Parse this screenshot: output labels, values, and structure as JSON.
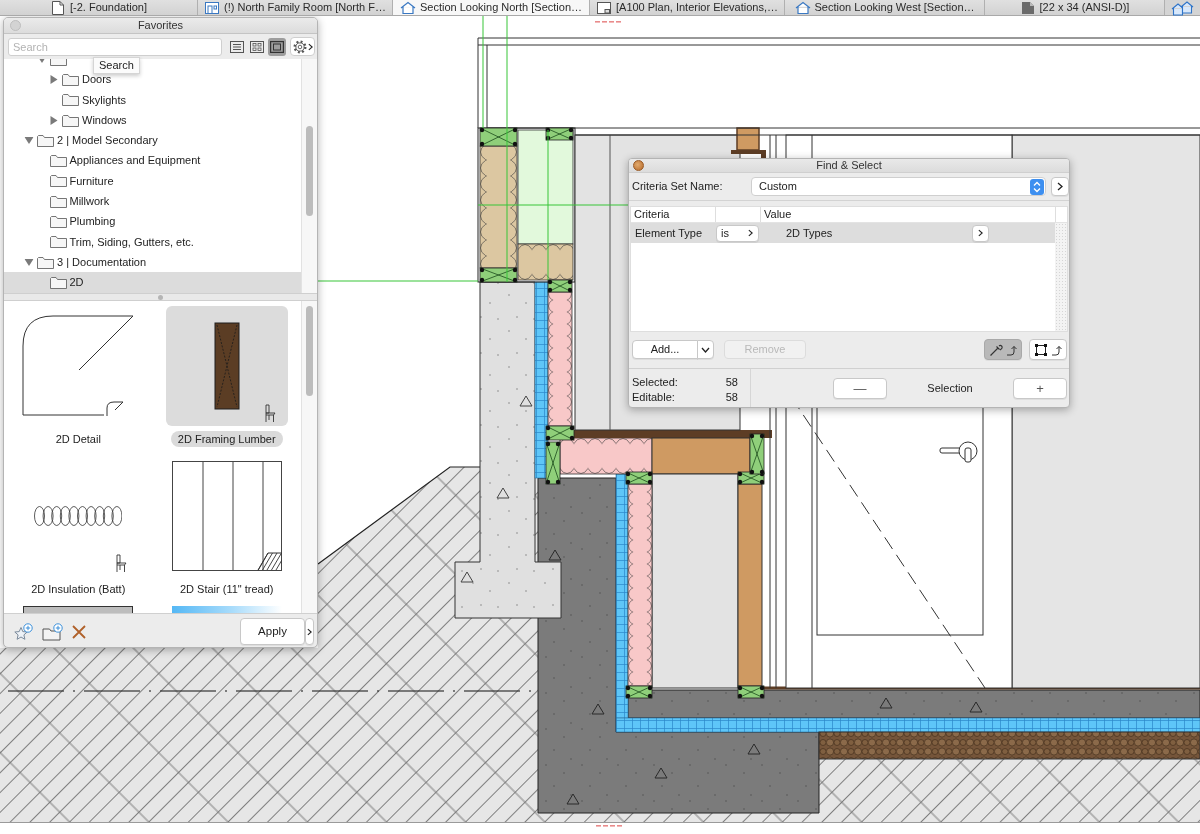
{
  "tabs": [
    {
      "label": "[-2. Foundation]",
      "kind": "plan",
      "selected": false
    },
    {
      "label": "(!) North Family Room [North F…",
      "kind": "elevation",
      "selected": false
    },
    {
      "label": "Section Looking North [Section…",
      "kind": "section",
      "selected": true
    },
    {
      "label": "[A100 Plan, Interior Elevations,…",
      "kind": "layout",
      "selected": false
    },
    {
      "label": "Section Looking West [Section…",
      "kind": "section",
      "selected": false
    },
    {
      "label": "[22 x 34 (ANSI-D)]",
      "kind": "master",
      "selected": false
    }
  ],
  "favorites": {
    "title": "Favorites",
    "search": {
      "placeholder": "Search"
    },
    "tooltip": "Search",
    "view_modes": [
      {
        "kind": "list",
        "selected": false
      },
      {
        "kind": "grid",
        "selected": false
      },
      {
        "kind": "preview",
        "selected": true
      }
    ],
    "tree": {
      "continued": [
        {
          "expanded": true,
          "selected": false,
          "children": [
            {
              "label": "Doors",
              "expanded": false,
              "selected": false
            },
            {
              "label": "Skylights",
              "selected": false
            },
            {
              "label": "Windows",
              "expanded": false,
              "selected": false
            }
          ]
        }
      ],
      "items": [
        {
          "label": "2 | Model Secondary",
          "expanded": true,
          "selected": false,
          "children": [
            {
              "label": "Appliances and Equipment",
              "selected": false
            },
            {
              "label": "Furniture",
              "selected": false
            },
            {
              "label": "Millwork",
              "selected": false
            },
            {
              "label": "Plumbing",
              "selected": false
            },
            {
              "label": "Trim, Siding, Gutters, etc.",
              "selected": false
            }
          ]
        },
        {
          "label": "3 | Documentation",
          "expanded": true,
          "selected": false,
          "children": [
            {
              "label": "2D",
              "selected": true
            }
          ]
        }
      ]
    },
    "previews": [
      {
        "label": "2D Detail",
        "kind": "detail",
        "selected": false,
        "object": false
      },
      {
        "label": "2D Framing Lumber",
        "kind": "lumber",
        "selected": true,
        "object": true
      },
      {
        "label": "2D Insulation (Batt)",
        "kind": "batt",
        "selected": false,
        "object": true
      },
      {
        "label": "2D Stair (11\" tread)",
        "kind": "stair",
        "selected": false,
        "object": false
      },
      {
        "kind": "fill",
        "selected": false
      },
      {
        "kind": "gradient",
        "selected": false
      }
    ],
    "footer": {
      "apply": "Apply"
    }
  },
  "find_select": {
    "title": "Find & Select",
    "criteria_set": {
      "label": "Criteria Set Name:",
      "value": "Custom"
    },
    "columns": [
      "Criteria",
      "Value"
    ],
    "rows": [
      {
        "criteria": "Element Type",
        "operator": "is",
        "value": "2D Types",
        "selected": true
      }
    ],
    "add": "Add...",
    "remove": {
      "label": "Remove",
      "disabled": true
    },
    "pick_tools": [
      {
        "kind": "eyedropper",
        "on": true
      },
      {
        "kind": "marquee",
        "on": false
      }
    ],
    "counts": [
      {
        "label": "Selected:",
        "value": "58"
      },
      {
        "label": "Editable:",
        "value": "58"
      }
    ],
    "selection": {
      "minus": "—",
      "label": "Selection",
      "plus": "+"
    }
  }
}
